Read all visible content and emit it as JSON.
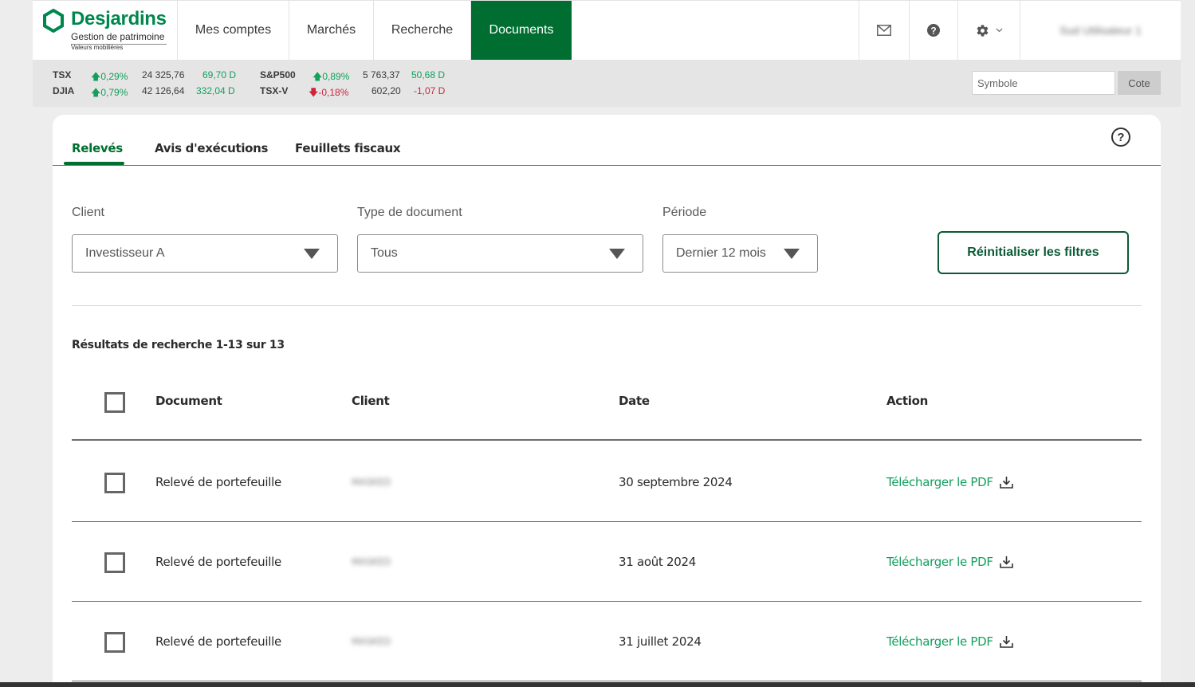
{
  "header": {
    "brand": "Desjardins",
    "subtitle": "Gestion de patrimoine",
    "subtitle2": "Valeurs mobilières",
    "nav": [
      {
        "label": "Mes comptes",
        "active": false
      },
      {
        "label": "Marchés",
        "active": false
      },
      {
        "label": "Recherche",
        "active": false
      },
      {
        "label": "Documents",
        "active": true
      }
    ],
    "icons": [
      "mail-icon",
      "help-icon",
      "gear-icon"
    ],
    "user_name": "Sud Utilisateur 1"
  },
  "ticker": {
    "rows": [
      {
        "symbol": "TSX",
        "direction": "up",
        "pct": "0,29%",
        "value": "24 325,76",
        "change": "69,70 D"
      },
      {
        "symbol": "DJIA",
        "direction": "up",
        "pct": "0,79%",
        "value": "42 126,64",
        "change": "332,04 D"
      },
      {
        "symbol": "S&P500",
        "direction": "up",
        "pct": "0,89%",
        "value": "5 763,37",
        "change": "50,68 D"
      },
      {
        "symbol": "TSX-V",
        "direction": "down",
        "pct": "-0,18%",
        "value": "602,20",
        "change": "-1,07 D"
      }
    ],
    "symbol_placeholder": "Symbole",
    "quote_button": "Cote"
  },
  "tabs": [
    {
      "label": "Relevés",
      "active": true
    },
    {
      "label": "Avis d'exécutions",
      "active": false
    },
    {
      "label": "Feuillets fiscaux",
      "active": false
    }
  ],
  "filters": {
    "client": {
      "label": "Client",
      "value": "Investisseur A"
    },
    "doc_type": {
      "label": "Type de document",
      "value": "Tous"
    },
    "period": {
      "label": "Période",
      "value": "Dernier 12 mois"
    },
    "reset_label": "Réinitialiser les filtres"
  },
  "results_text": "Résultats de recherche 1-13 sur 13",
  "table": {
    "headers": [
      "Document",
      "Client",
      "Date",
      "Action"
    ],
    "rows": [
      {
        "document": "Relevé de portefeuille",
        "client": "MASKED",
        "date": "30 septembre 2024",
        "action": "Télécharger le PDF"
      },
      {
        "document": "Relevé de portefeuille",
        "client": "MASKED",
        "date": "31 août 2024",
        "action": "Télécharger le PDF"
      },
      {
        "document": "Relevé de portefeuille",
        "client": "MASKED",
        "date": "31 juillet 2024",
        "action": "Télécharger le PDF"
      }
    ]
  },
  "colors": {
    "brand_green": "#00874e",
    "active_nav": "#006e31",
    "up": "#12a05c",
    "down": "#d0233c",
    "link": "#12a05c"
  }
}
